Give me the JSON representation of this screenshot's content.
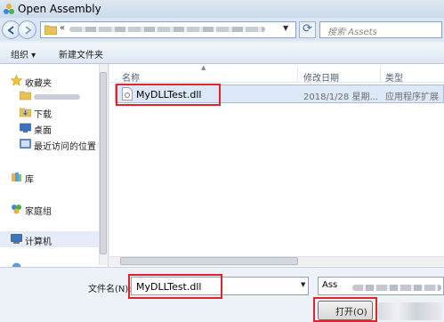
{
  "window": {
    "title": "Open Assembly"
  },
  "address_bar": {
    "prefix": "«",
    "folder_path": ""
  },
  "search": {
    "placeholder": "搜索 Assets"
  },
  "toolbar": {
    "organize_label": "组织 ▾",
    "new_folder_label": "新建文件夹"
  },
  "nav_pane": {
    "items": [
      {
        "label": "收藏夹",
        "icon": "star-icon"
      },
      {
        "label": "",
        "icon": "folder-icon"
      },
      {
        "label": "下载",
        "icon": "download-folder-icon"
      },
      {
        "label": "桌面",
        "icon": "desktop-icon"
      },
      {
        "label": "最近访问的位置",
        "icon": "recent-places-icon"
      },
      {
        "label": "库",
        "icon": "library-icon"
      },
      {
        "label": "家庭组",
        "icon": "homegroup-icon"
      },
      {
        "label": "计算机",
        "icon": "computer-icon"
      }
    ]
  },
  "file_list": {
    "columns": [
      "名称",
      "修改日期",
      "类型"
    ],
    "files": [
      {
        "name": "MyDLLTest.dll",
        "modified": "2018/1/28 星期...",
        "type": "应用程序扩展"
      }
    ]
  },
  "bottom": {
    "filename_label": "文件名(N):",
    "filename_value": "MyDLLTest.dll",
    "filter_text": "Ass",
    "open_label": "打开(O)"
  },
  "colors": {
    "highlight_box": "#e0242a",
    "selection": "#dce8f7",
    "window_bg": "#e8eef7"
  }
}
